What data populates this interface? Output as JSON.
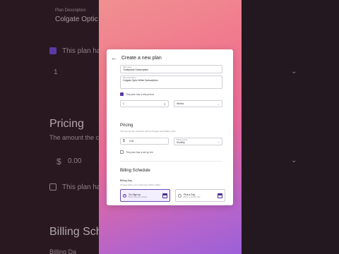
{
  "background_page": {
    "plan_description_label": "Plan Description",
    "plan_description_value": "Colgate Optic W",
    "plan_checkbox_label": "This plan has",
    "interval_value": "1",
    "pricing_title": "Pricing",
    "pricing_sub": "The amount the c",
    "amount_value": "0.00",
    "currency_symbol": "$",
    "setup_checkbox_label": "This plan has",
    "billing_title": "Billing Sche",
    "billing_day_label": "Billing Da"
  },
  "dialog": {
    "title": "Create a new plan",
    "back_icon": "arrow-left-icon",
    "plan_name_label": "Plan name",
    "plan_name_value": "Toothpaste Subscription",
    "plan_description_label": "Plan description",
    "plan_description_value": "Colgate Optic White Subscription",
    "trial_checkbox_label": "This plan has a trial period",
    "trial_checked": true,
    "trial_length_value": "1",
    "trial_unit_value": "Weeks",
    "pricing_title": "Pricing",
    "pricing_sub": "The amount the customer will be charged each billing cycle",
    "currency_symbol": "$",
    "amount_value": "0.00",
    "billing_period_label": "Billing period",
    "billing_period_value": "Monthly",
    "setup_fee_label": "This plan has a set up fee",
    "setup_fee_checked": false,
    "billing_schedule_title": "Billing Schedule",
    "billing_day_title": "Billing Day",
    "billing_day_sub": "Choose when your customers will be billed",
    "options": [
      {
        "title": "On Sign-up",
        "sub": "Bill on day of purchase",
        "selected": true
      },
      {
        "title": "Pick a Day",
        "sub": "Bill on a specific day",
        "selected": false
      }
    ]
  },
  "colors": {
    "accent": "#5b3aa6",
    "gradient_top": "#f09090",
    "gradient_bottom": "#9c60d8"
  }
}
